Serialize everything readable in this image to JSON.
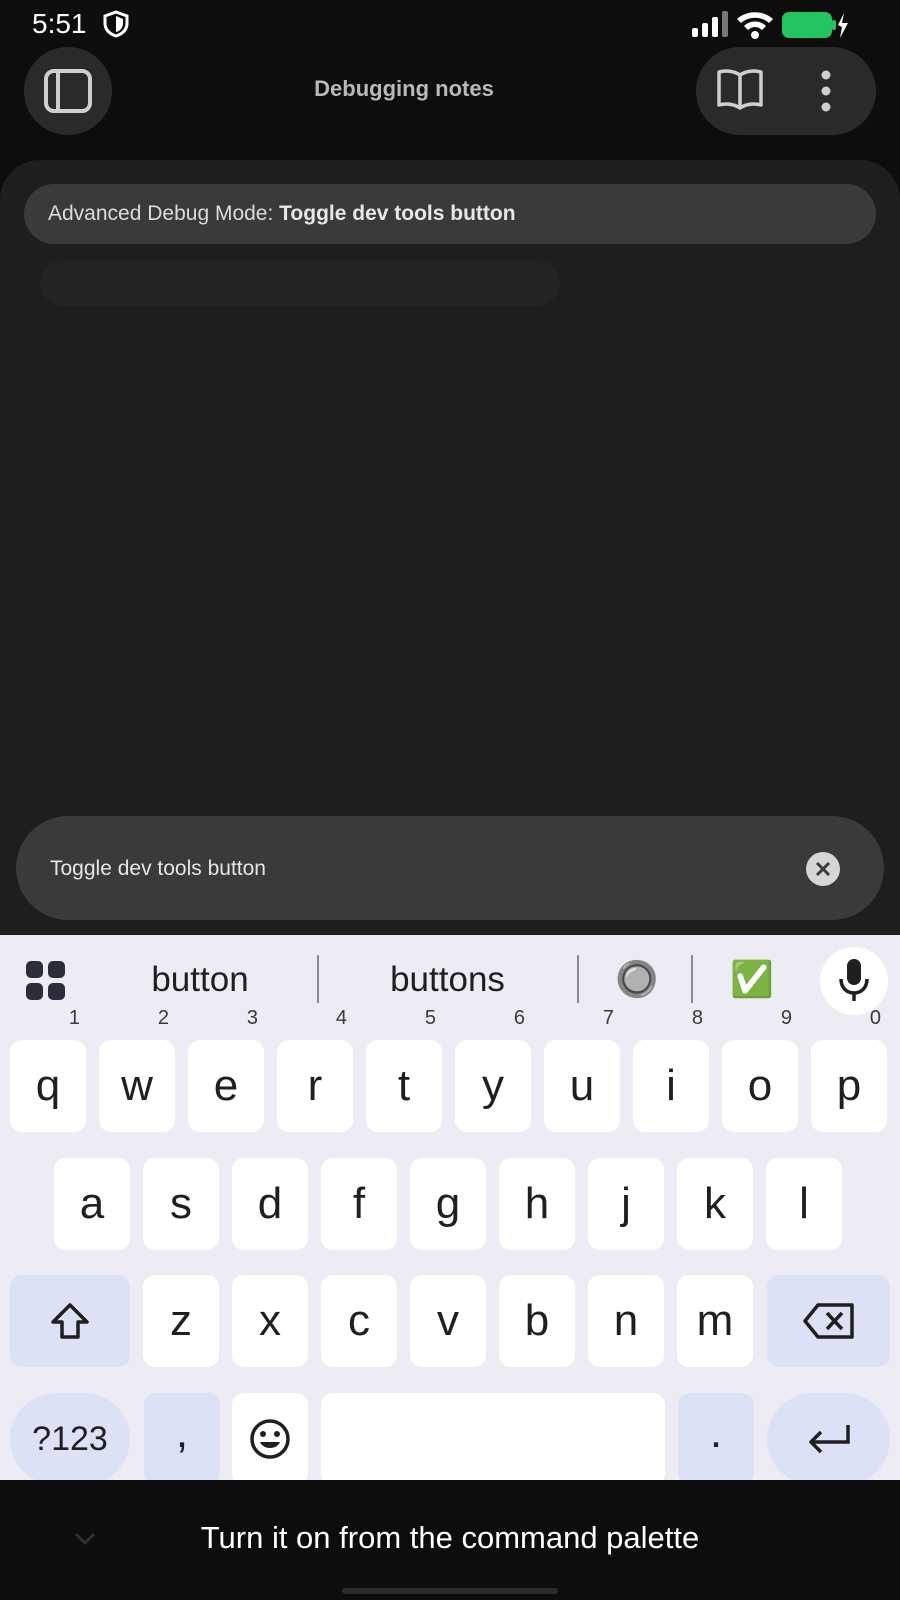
{
  "status_bar": {
    "time": "5:51"
  },
  "header": {
    "title": "Debugging notes"
  },
  "banner": {
    "prefix": "Advanced Debug Mode: ",
    "highlight": "Toggle dev tools button"
  },
  "search": {
    "value": "Toggle dev tools button"
  },
  "keyboard": {
    "suggestions": [
      "button",
      "buttons",
      "🔘",
      "✅"
    ],
    "row1": [
      {
        "k": "q",
        "h": "1"
      },
      {
        "k": "w",
        "h": "2"
      },
      {
        "k": "e",
        "h": "3"
      },
      {
        "k": "r",
        "h": "4"
      },
      {
        "k": "t",
        "h": "5"
      },
      {
        "k": "y",
        "h": "6"
      },
      {
        "k": "u",
        "h": "7"
      },
      {
        "k": "i",
        "h": "8"
      },
      {
        "k": "o",
        "h": "9"
      },
      {
        "k": "p",
        "h": "0"
      }
    ],
    "row2": [
      "a",
      "s",
      "d",
      "f",
      "g",
      "h",
      "j",
      "k",
      "l"
    ],
    "row3": [
      "z",
      "x",
      "c",
      "v",
      "b",
      "n",
      "m"
    ],
    "symbols_label": "?123",
    "comma": ",",
    "period": "."
  },
  "caption": "Turn it on from the command palette",
  "colors": {
    "panel": "#1e1e1e",
    "keyboard": "#edecf4",
    "battery": "#22c55e"
  }
}
